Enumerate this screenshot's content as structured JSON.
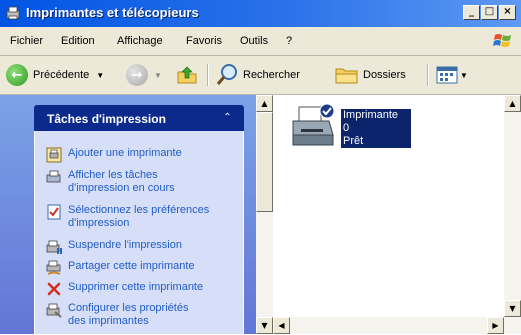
{
  "window": {
    "title": "Imprimantes et télécopieurs",
    "minimize_glyph": "_",
    "maximize_glyph": "□",
    "close_glyph": "×"
  },
  "menu": {
    "items": [
      "Fichier",
      "Edition",
      "Affichage",
      "Favoris",
      "Outils",
      "?"
    ]
  },
  "toolbar": {
    "back_label": "Précédente",
    "search_label": "Rechercher",
    "folders_label": "Dossiers"
  },
  "tasks": {
    "header": "Tâches d'impression",
    "items": [
      {
        "label_line1": "Ajouter une imprimante",
        "label_line2": "",
        "icon": "add-printer-icon"
      },
      {
        "label_line1": "Afficher les tâches",
        "label_line2": "d'impression en cours",
        "icon": "print-queue-icon"
      },
      {
        "label_line1": "Sélectionnez les préférences",
        "label_line2": "d'impression",
        "icon": "preferences-icon"
      },
      {
        "label_line1": "Suspendre l'impression",
        "label_line2": "",
        "icon": "pause-printer-icon"
      },
      {
        "label_line1": "Partager cette imprimante",
        "label_line2": "",
        "icon": "share-printer-icon"
      },
      {
        "label_line1": "Supprimer cette imprimante",
        "label_line2": "",
        "icon": "delete-icon"
      },
      {
        "label_line1": "Configurer les propriétés",
        "label_line2": "des imprimantes",
        "icon": "properties-icon"
      }
    ]
  },
  "printer": {
    "name": "Imprimante",
    "jobs": "0",
    "status": "Prêt"
  },
  "colors": {
    "titlebar": "#0054e3",
    "task_header": "#0c2a8c",
    "task_link": "#215dc6",
    "selection": "#0b246b"
  }
}
